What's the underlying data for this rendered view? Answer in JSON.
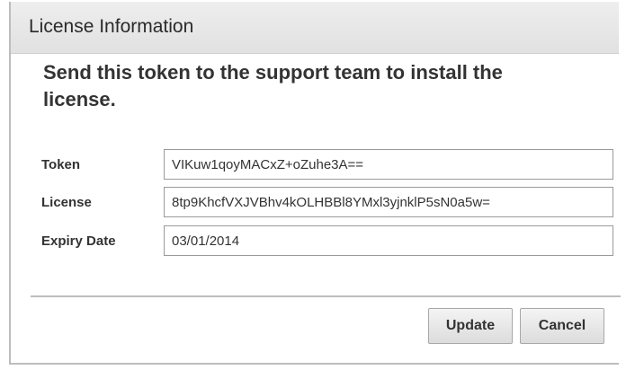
{
  "dialog": {
    "title": "License Information",
    "message": "Send this token to the support team to install the license.",
    "fields": [
      {
        "label": "Token",
        "value": "VIKuw1qoyMACxZ+oZuhe3A=="
      },
      {
        "label": "License",
        "value": "8tp9KhcfVXJVBhv4kOLHBBl8YMxl3yjnklP5sN0a5w="
      },
      {
        "label": "Expiry Date",
        "value": "03/01/2014"
      }
    ],
    "buttons": {
      "update_label": "Update",
      "cancel_label": "Cancel"
    }
  }
}
